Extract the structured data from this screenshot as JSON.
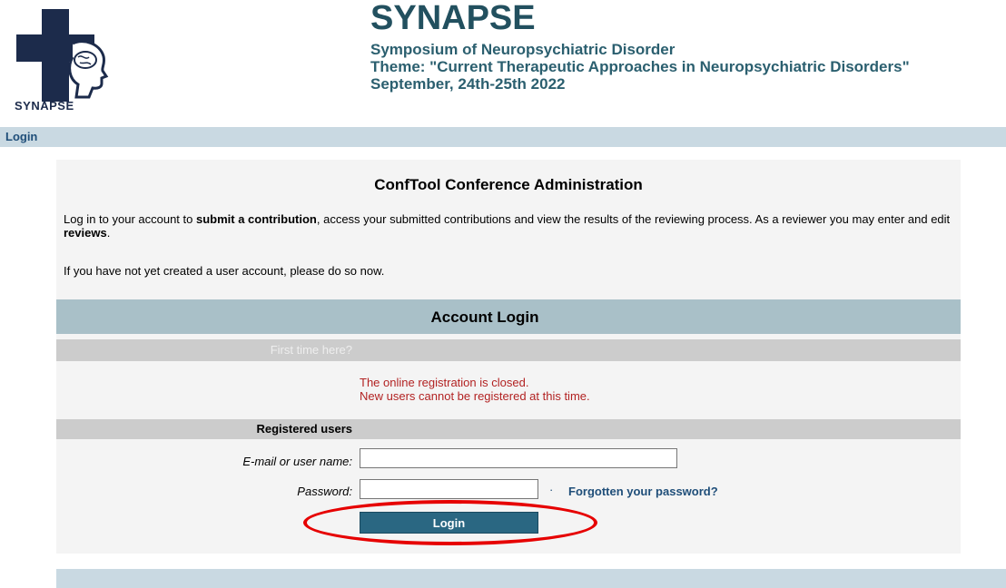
{
  "header": {
    "logo_text": "SYNAPSE",
    "title": "SYNAPSE",
    "subtitle_lines": [
      "Symposium of Neuropsychiatric Disorder",
      "Theme: \"Current Therapeutic Approaches in Neuropsychiatric Disorders\"",
      "September, 24th-25th 2022"
    ]
  },
  "nav": {
    "login_link": "Login"
  },
  "main": {
    "title": "ConfTool Conference Administration",
    "intro_parts": [
      "Log in to your account to ",
      "submit a contribution",
      ", access your submitted contributions and view the results of the reviewing process. As a reviewer you may enter and edit ",
      "reviews",
      "."
    ],
    "intro2": "If you have not yet created a user account, please do so now."
  },
  "login": {
    "header": "Account Login",
    "first_time": "First time here?",
    "closed_line1": "The online registration is closed.",
    "closed_line2": "New users cannot be registered at this time.",
    "registered_users": "Registered users",
    "email_label": "E-mail or user name:",
    "email_value": "",
    "password_label": "Password:",
    "password_value": "",
    "forgot_bullet": "·",
    "forgot_link": "Forgotten your password?",
    "button": "Login"
  },
  "colors": {
    "brand_title": "#22505f",
    "nav_bar": "#c9d9e2",
    "login_header": "#a9c0c8",
    "button": "#2a6782",
    "closed_text": "#b22222",
    "highlight_circle": "#e60000"
  }
}
